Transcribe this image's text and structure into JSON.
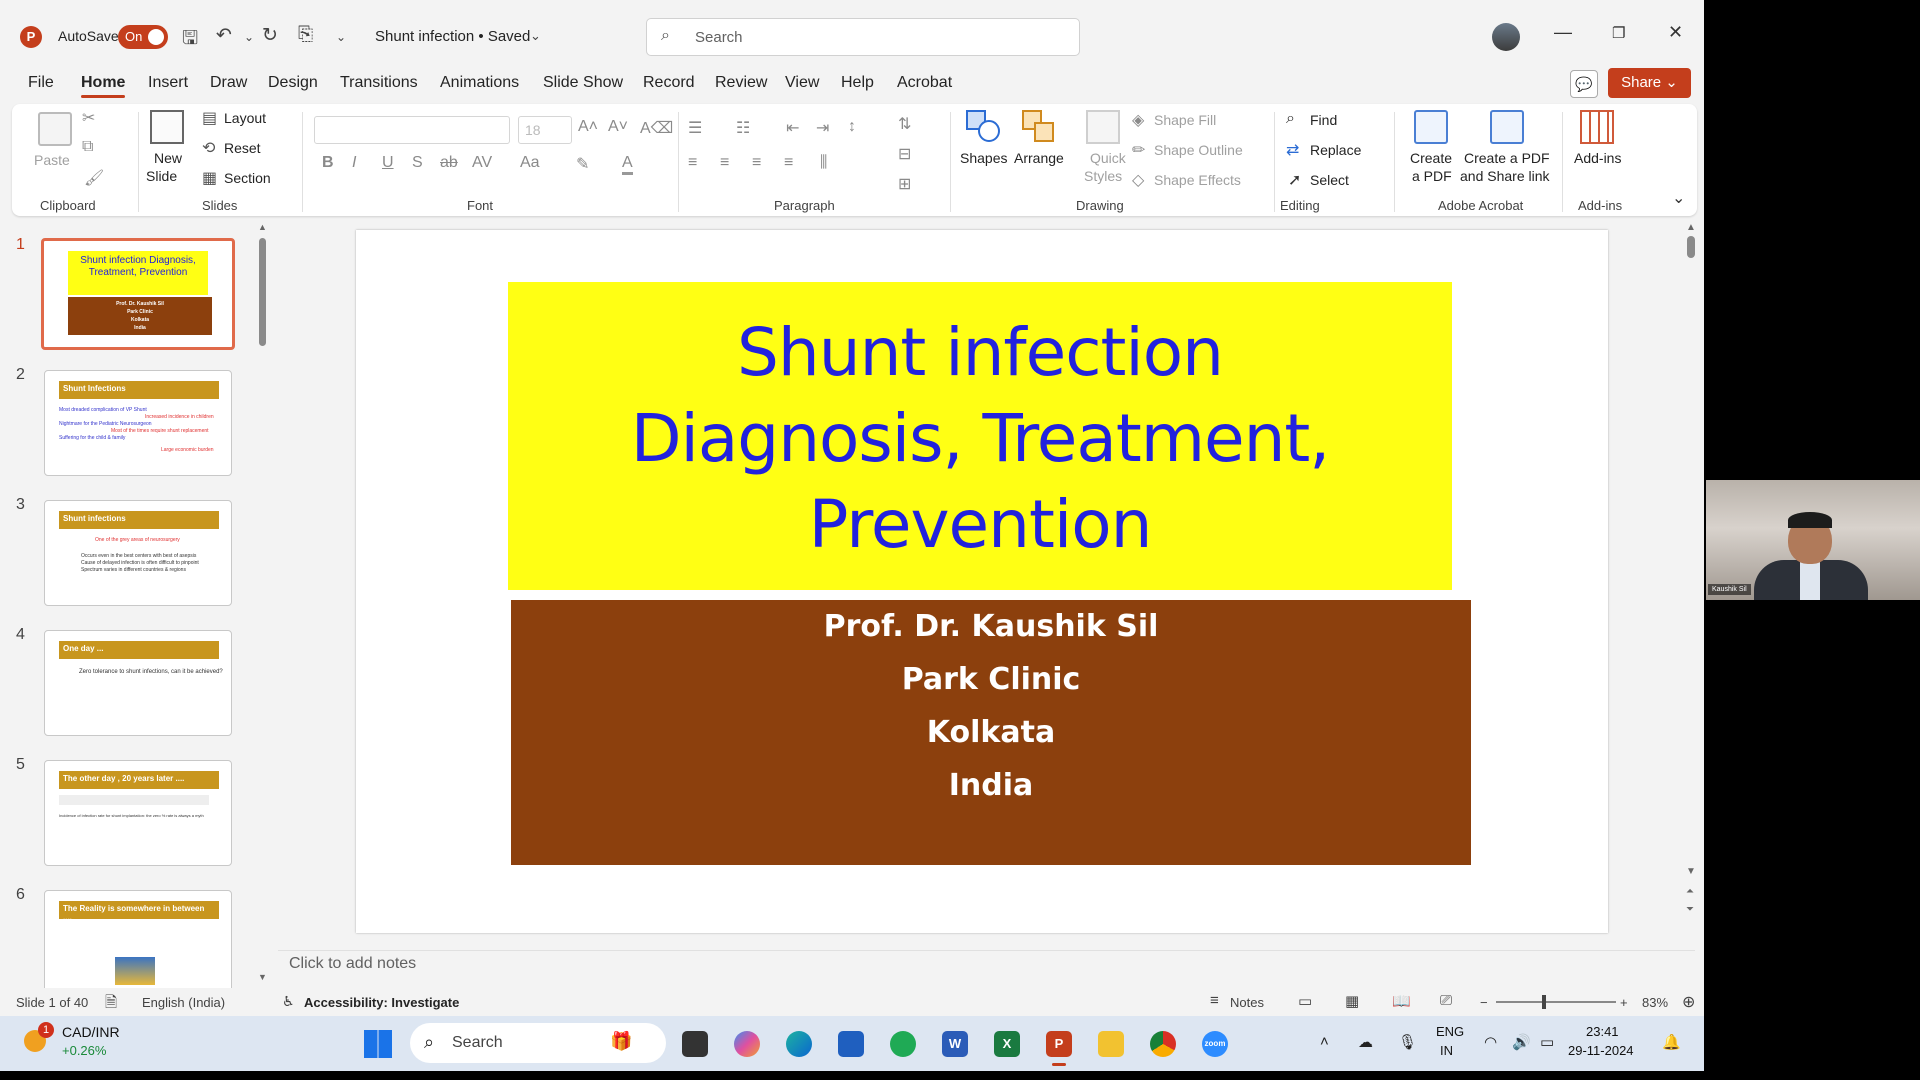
{
  "titlebar": {
    "autosave_label": "AutoSave",
    "autosave_state": "On",
    "doc_title": "Shunt infection • Saved",
    "search_placeholder": "Search"
  },
  "tabs": [
    "File",
    "Home",
    "Insert",
    "Draw",
    "Design",
    "Transitions",
    "Animations",
    "Slide Show",
    "Record",
    "Review",
    "View",
    "Help",
    "Acrobat"
  ],
  "share_label": "Share",
  "ribbon": {
    "clipboard": {
      "label": "Clipboard",
      "paste": "Paste"
    },
    "slides": {
      "label": "Slides",
      "new_slide": "New",
      "new_slide2": "Slide",
      "layout": "Layout",
      "reset": "Reset",
      "section": "Section"
    },
    "font": {
      "label": "Font",
      "size": "18"
    },
    "paragraph": {
      "label": "Paragraph"
    },
    "drawing": {
      "label": "Drawing",
      "shapes": "Shapes",
      "arrange": "Arrange",
      "quick_styles": "Quick",
      "quick_styles2": "Styles",
      "shape_fill": "Shape Fill",
      "shape_outline": "Shape Outline",
      "shape_effects": "Shape Effects"
    },
    "editing": {
      "label": "Editing",
      "find": "Find",
      "replace": "Replace",
      "select": "Select"
    },
    "acrobat": {
      "label": "Adobe Acrobat",
      "create_pdf": "Create",
      "create_pdf2": "a PDF",
      "create_share": "Create a PDF",
      "create_share2": "and Share link"
    },
    "addins": {
      "label": "Add-ins",
      "addins": "Add-ins"
    }
  },
  "thumbnails": [
    {
      "num": "1",
      "title": "Shunt infection Diagnosis, Treatment, Prevention",
      "lines": [
        "Prof. Dr. Kaushik Sil",
        "Park Clinic",
        "Kolkata",
        "India"
      ]
    },
    {
      "num": "2",
      "title": "Shunt Infections",
      "lines": [
        "Most dreaded complication of VP Shunt",
        "Increased incidence in children",
        "Nightmare for the Pediatric Neurosurgeon",
        "Most of the times require shunt replacement",
        "Suffering for the child & family",
        "Large economic burden"
      ]
    },
    {
      "num": "3",
      "title": "Shunt infections",
      "lines": [
        "One of the grey areas of neurosurgery",
        "Occurs even in the best centers with best of asepsis",
        "Cause of delayed infection is often difficult to pinpoint",
        "Spectrum varies in different countries & regions"
      ]
    },
    {
      "num": "4",
      "title": "One day ...",
      "lines": [
        "Zero tolerance to shunt infections, can it be achieved?"
      ]
    },
    {
      "num": "5",
      "title": "The other day , 20 years later ....",
      "lines": [
        "Incidence of infection rate for shunt implantation: the zero % rate is always a myth"
      ]
    },
    {
      "num": "6",
      "title": "The Reality is somewhere in between ....",
      "lines": []
    }
  ],
  "slide": {
    "title_lines": [
      "Shunt infection",
      "Diagnosis, Treatment,",
      "Prevention"
    ],
    "author_lines": [
      "Prof. Dr. Kaushik Sil",
      "Park Clinic",
      "Kolkata",
      "India"
    ],
    "title_bg": "#ffff14",
    "title_color": "#2222dd",
    "author_bg": "#8c400d"
  },
  "notes_placeholder": "Click to add notes",
  "status": {
    "slide_of": "Slide 1 of 40",
    "language": "English (India)",
    "accessibility": "Accessibility: Investigate",
    "notes": "Notes",
    "zoom": "83%"
  },
  "taskbar": {
    "stock": "CAD/INR",
    "stock_change": "+0.26%",
    "badge": "1",
    "search": "Search",
    "lang1": "ENG",
    "lang2": "IN",
    "time": "23:41",
    "date": "29-11-2024"
  },
  "webcam": {
    "name": "Kaushik Sil"
  },
  "accent": "#c43e1c"
}
